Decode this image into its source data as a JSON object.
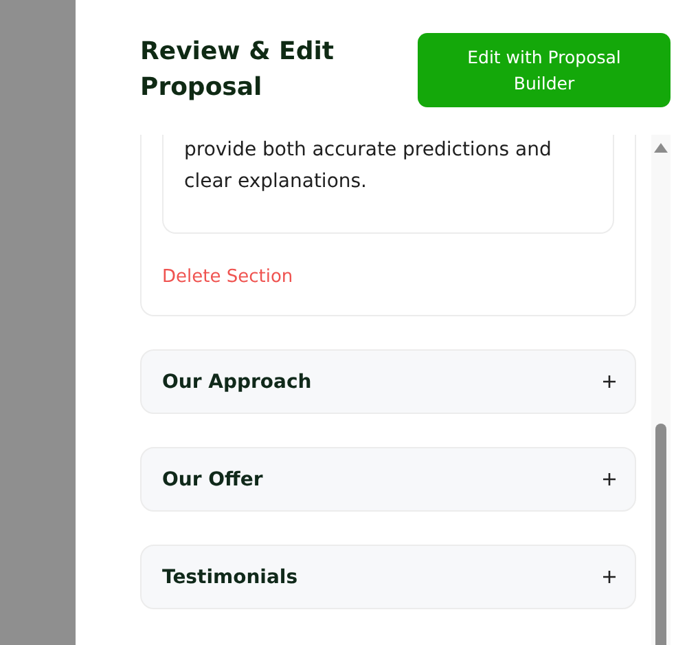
{
  "header": {
    "title": "Review & Edit Proposal",
    "action_button": "Edit with Proposal Builder"
  },
  "open_section": {
    "text": "provide both accurate predictions and clear explanations.",
    "delete_label": "Delete Section"
  },
  "sections": [
    {
      "title": "Our Approach",
      "expanded": false
    },
    {
      "title": "Our Offer",
      "expanded": false
    },
    {
      "title": "Testimonials",
      "expanded": false
    }
  ]
}
